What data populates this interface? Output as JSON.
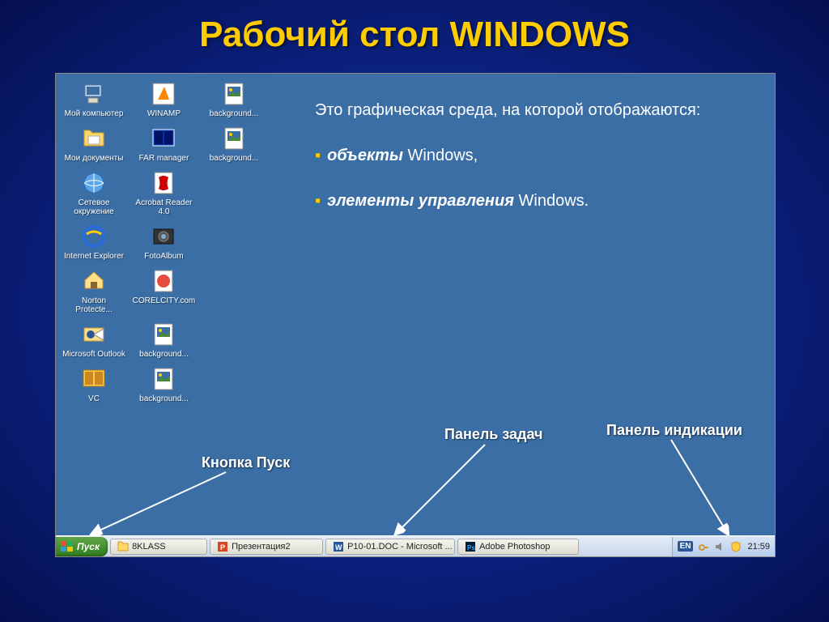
{
  "title": "Рабочий стол WINDOWS",
  "description": {
    "intro": "Это графическая среда, на которой отображаются:",
    "bullet1_bold": "объекты",
    "bullet1_rest": " Windows,",
    "bullet2_bold": "элементы управления",
    "bullet2_rest": " Windows."
  },
  "annotations": {
    "start": "Кнопка Пуск",
    "taskbar": "Панель задач",
    "tray": "Панель индикации"
  },
  "icons": [
    {
      "label": "Мой компьютер",
      "type": "computer"
    },
    {
      "label": "WINAMP",
      "type": "winamp"
    },
    {
      "label": "background...",
      "type": "image"
    },
    {
      "label": "Мои документы",
      "type": "folder-docs"
    },
    {
      "label": "FAR manager",
      "type": "far"
    },
    {
      "label": "background...",
      "type": "image"
    },
    {
      "label": "Сетевое окружение",
      "type": "network"
    },
    {
      "label": "Acrobat Reader 4.0",
      "type": "acrobat"
    },
    {
      "label": "",
      "type": "spacer"
    },
    {
      "label": "Internet Explorer",
      "type": "ie"
    },
    {
      "label": "FotoAlbum",
      "type": "fotoalbum"
    },
    {
      "label": "",
      "type": "spacer"
    },
    {
      "label": "Norton Protecte...",
      "type": "norton"
    },
    {
      "label": "CORELCITY.com",
      "type": "corel"
    },
    {
      "label": "",
      "type": "spacer"
    },
    {
      "label": "Microsoft Outlook",
      "type": "outlook"
    },
    {
      "label": "background...",
      "type": "image"
    },
    {
      "label": "",
      "type": "spacer"
    },
    {
      "label": "VC",
      "type": "vc"
    },
    {
      "label": "background...",
      "type": "image"
    }
  ],
  "start_label": "Пуск",
  "taskbar_items": [
    {
      "label": "8KLASS",
      "icon": "folder"
    },
    {
      "label": "Презентация2",
      "icon": "ppt"
    },
    {
      "label": "P10-01.DOC - Microsoft ...",
      "icon": "word"
    },
    {
      "label": "Adobe Photoshop",
      "icon": "ps"
    }
  ],
  "tray": {
    "lang": "EN",
    "clock": "21:59"
  }
}
